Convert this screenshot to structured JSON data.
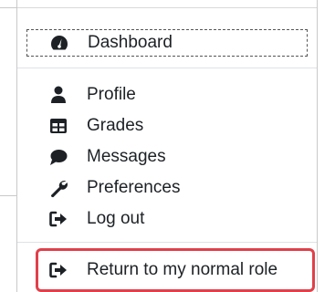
{
  "user_menu": {
    "items": [
      {
        "label": "Dashboard",
        "icon": "tachometer-icon"
      },
      {
        "label": "Profile",
        "icon": "user-icon"
      },
      {
        "label": "Grades",
        "icon": "table-icon"
      },
      {
        "label": "Messages",
        "icon": "speech-bubble-icon"
      },
      {
        "label": "Preferences",
        "icon": "wrench-icon"
      },
      {
        "label": "Log out",
        "icon": "sign-out-icon"
      }
    ],
    "return_item": {
      "label": "Return to my normal role",
      "icon": "sign-out-icon"
    }
  },
  "colors": {
    "highlight": "#e0404a",
    "text": "#1d2125"
  }
}
